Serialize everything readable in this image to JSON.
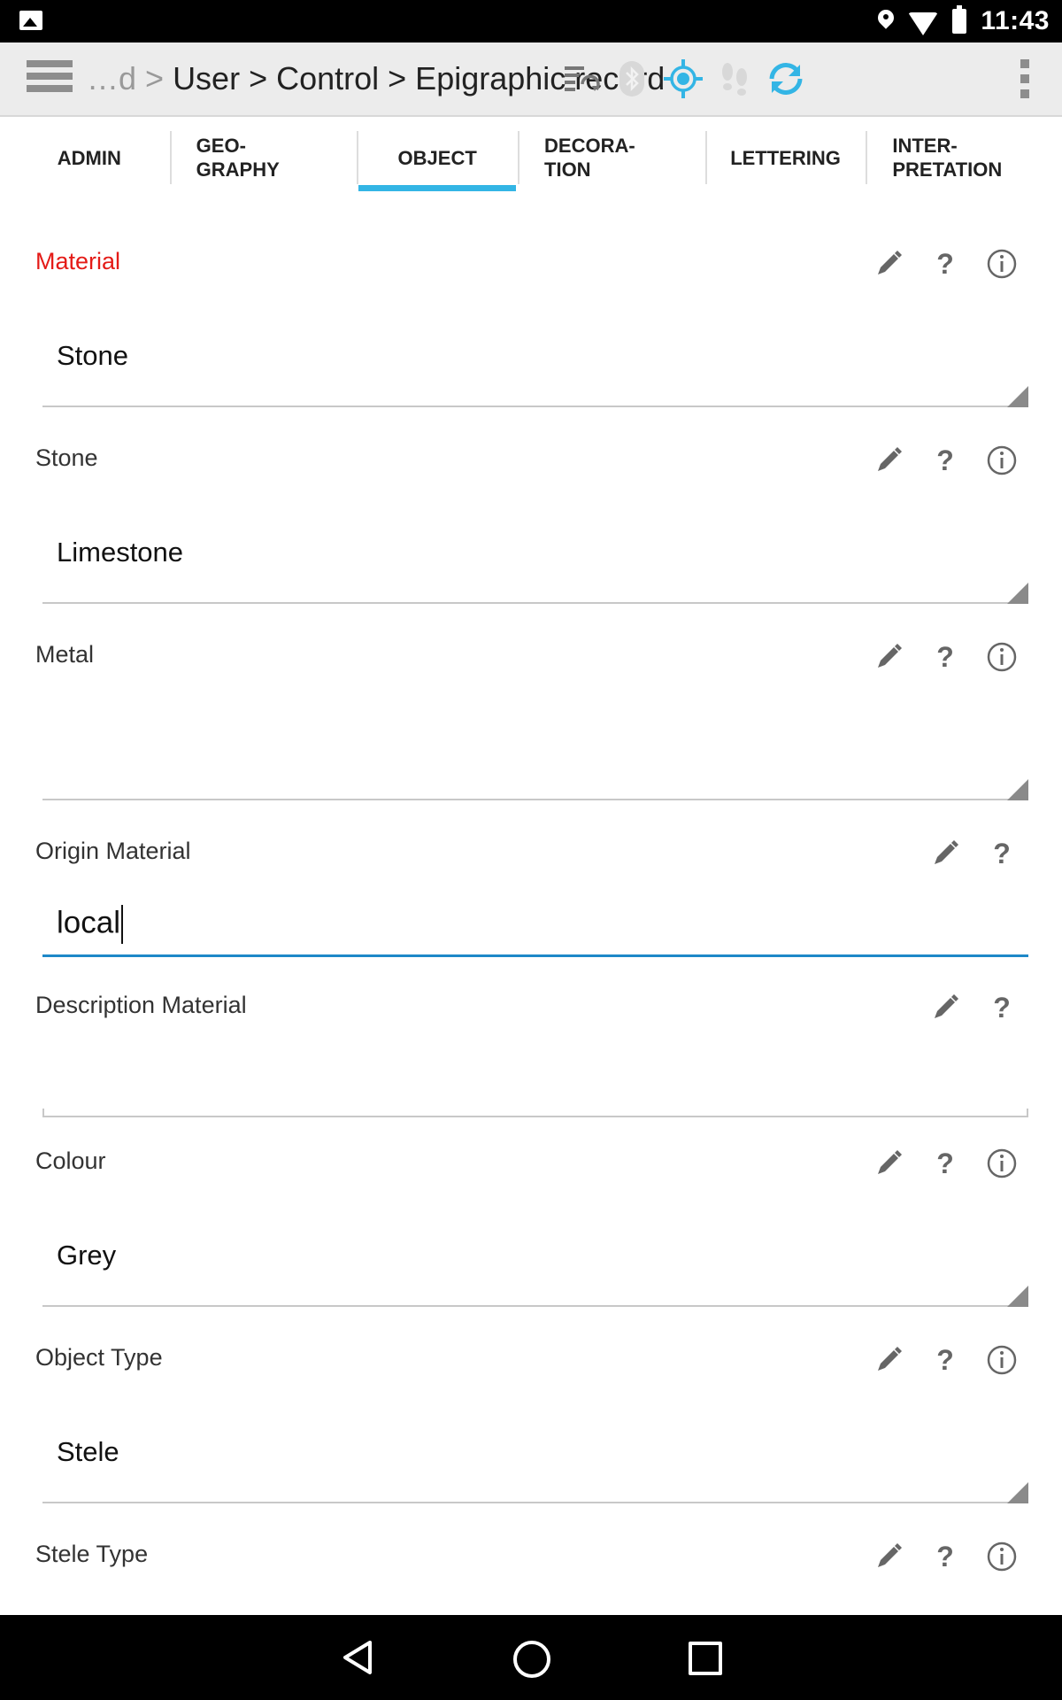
{
  "status_bar": {
    "time": "11:43"
  },
  "action_bar": {
    "breadcrumb_prefix": "…d >",
    "breadcrumb_path": "User > Control > Epigraphic record",
    "icons": [
      "menu-icon",
      "sync-list-icon",
      "bluetooth-icon",
      "gps-icon",
      "footsteps-icon",
      "refresh-icon",
      "overflow-menu-icon"
    ]
  },
  "tabs": [
    {
      "label": "ADMIN"
    },
    {
      "label": "GEO-\nGRAPHY"
    },
    {
      "label": "OBJECT",
      "active": true
    },
    {
      "label": "DECORA-\nTION"
    },
    {
      "label": "LETTERING"
    },
    {
      "label": "INTER-\nPRETATION"
    }
  ],
  "fields": {
    "material": {
      "label": "Material",
      "value": "Stone"
    },
    "stone": {
      "label": "Stone",
      "value": "Limestone"
    },
    "metal": {
      "label": "Metal",
      "value": ""
    },
    "origin_material": {
      "label": "Origin Material",
      "value": "local"
    },
    "description_material": {
      "label": "Description Material",
      "value": ""
    },
    "colour": {
      "label": "Colour",
      "value": "Grey"
    },
    "object_type": {
      "label": "Object Type",
      "value": "Stele"
    },
    "stele_type": {
      "label": "Stele Type",
      "value": ""
    }
  },
  "icon_glyphs": {
    "help": "?"
  },
  "colors": {
    "accent": "#33b5e5",
    "required_label": "#e41b17",
    "focused_underline": "#1e88c8"
  }
}
